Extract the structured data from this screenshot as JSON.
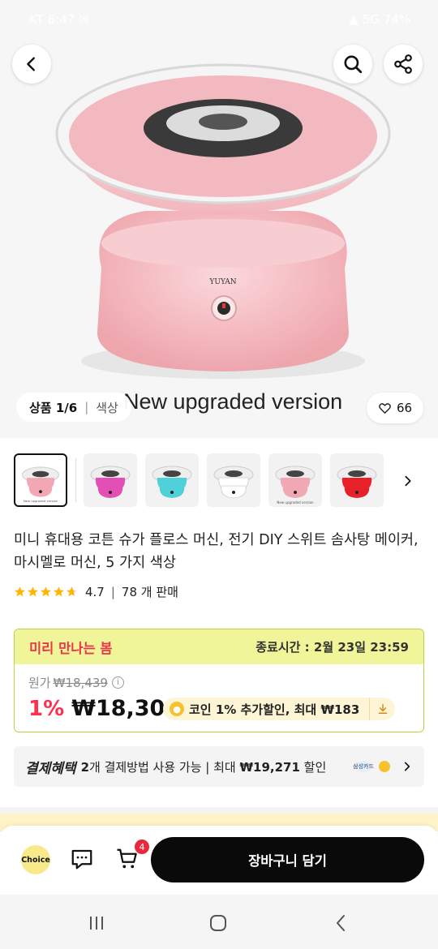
{
  "status_bar": {
    "left": "KT 8:47 ✉",
    "right": "▲ 5G 74%"
  },
  "hero": {
    "counter": "상품 1/6",
    "attribute": "색상",
    "upgraded_text": "New upgraded version",
    "likes": "66",
    "icons": {
      "back": "back-arrow-icon",
      "search": "search-icon",
      "share": "share-icon",
      "heart": "heart-icon"
    }
  },
  "thumbnails": [
    {
      "color": "#f2a7b5",
      "caption": "New upgraded version"
    },
    {
      "color": "#e24fb5",
      "caption": ""
    },
    {
      "color": "#4fd1d9",
      "caption": ""
    },
    {
      "color": "#ffffff",
      "caption": ""
    },
    {
      "color": "#f2a7b5",
      "caption": "New upgraded version"
    },
    {
      "color": "#e8202a",
      "caption": ""
    }
  ],
  "product": {
    "title": "미니 휴대용 코튼 슈가 플로스 머신, 전기 DIY 스위트 솜사탕 메이커, 마시멜로 머신, 5 가지 색상",
    "rating": "4.7",
    "rating_value": 4.7,
    "sold": "78 개 판매"
  },
  "promo": {
    "name": "미리 만나는 봄",
    "timer": "종료시간 :  2월 23일 23:59",
    "original_label": "원가",
    "original_price": "₩18,439",
    "discount": "1%",
    "price": "₩18,300",
    "coin_text": "코인 1% 추가할인, 최대 ₩183"
  },
  "benefit": {
    "label": "결제혜택",
    "count": "2",
    "text_pre": "개 결제방법 사용 가능 | 최대 ",
    "amount": "₩19,271",
    "text_post": " 할인",
    "badge": "삼성카드"
  },
  "bottom_bar": {
    "choice": "Choice",
    "cart_count": "4",
    "add_to_cart": "장바구니 담기"
  },
  "colors": {
    "accent_red": "#ff2f4e",
    "promo_yellow": "#f0f59a",
    "button_black": "#0a0a0a"
  }
}
